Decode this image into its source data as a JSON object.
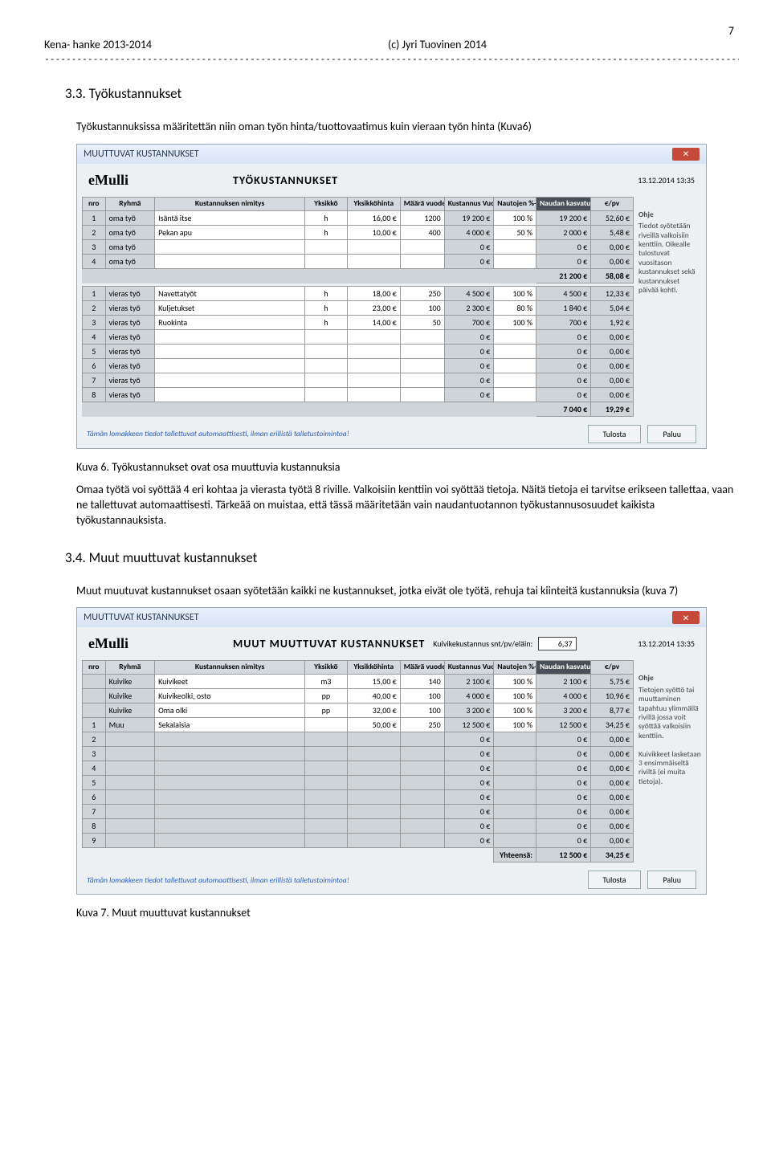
{
  "header": {
    "left": "Kena- hanke 2013-2014",
    "center": "(c) Jyri Tuovinen 2014",
    "page": "7"
  },
  "sec33": {
    "num_title": "3.3.   Työkustannukset",
    "p1": "Työkustannuksissa määritettän niin oman työn hinta/tuottovaatimus kuin vieraan työn hinta (Kuva6)",
    "caption": "Kuva 6. Työkustannukset ovat osa muuttuvia kustannuksia",
    "p2": "Omaa työtä voi syöttää 4 eri kohtaa ja vierasta työtä 8 riville. Valkoisiin kenttiin voi syöttää tietoja. Näitä tietoja ei tarvitse erikseen tallettaa, vaan ne tallettuvat automaattisesti. Tärkeää on muistaa, että tässä määritetään vain naudantuotannon työkustannusosuudet kaikista työkustannauksista."
  },
  "sec34": {
    "num_title": "3.4.   Muut muuttuvat kustannukset",
    "p1": "Muut muutuvat kustannukset osaan syötetään kaikki ne kustannukset, jotka eivät ole työtä, rehuja tai kiinteitä kustannuksia (kuva 7)",
    "caption": "Kuva 7. Muut muuttuvat kustannukset"
  },
  "dlg1": {
    "titlebar": "MUUTTUVAT KUSTANNUKSET",
    "brand": "eMulli",
    "title": "TYÖKUSTANNUKSET",
    "stamp": "13.12.2014 13:35",
    "cols": [
      "nro",
      "Ryhmä",
      "Kustannuksen nimitys",
      "Yksikkö",
      "Yksikköhinta",
      "Määrä vuodessa",
      "Kustannus Vuodessa",
      "Nautojen %- osuus",
      "Naudan kasvatuksen €/vuosi",
      "€/pv"
    ],
    "rows1": [
      [
        "1",
        "oma työ",
        "Isäntä itse",
        "h",
        "16,00 €",
        "1200",
        "19 200 €",
        "100 %",
        "19 200 €",
        "52,60 €"
      ],
      [
        "2",
        "oma työ",
        "Pekan apu",
        "h",
        "10,00 €",
        "400",
        "4 000 €",
        "50 %",
        "2 000 €",
        "5,48 €"
      ],
      [
        "3",
        "oma työ",
        "",
        "",
        "",
        "",
        "0 €",
        "",
        "0 €",
        "0,00 €"
      ],
      [
        "4",
        "oma työ",
        "",
        "",
        "",
        "",
        "0 €",
        "",
        "0 €",
        "0,00 €"
      ]
    ],
    "sum1": [
      "",
      "",
      "",
      "",
      "",
      "",
      "",
      "",
      "21 200 €",
      "58,08 €"
    ],
    "rows2": [
      [
        "1",
        "vieras työ",
        "Navettatyöt",
        "h",
        "18,00 €",
        "250",
        "4 500 €",
        "100 %",
        "4 500 €",
        "12,33 €"
      ],
      [
        "2",
        "vieras työ",
        "Kuljetukset",
        "h",
        "23,00 €",
        "100",
        "2 300 €",
        "80 %",
        "1 840 €",
        "5,04 €"
      ],
      [
        "3",
        "vieras työ",
        "Ruokinta",
        "h",
        "14,00 €",
        "50",
        "700 €",
        "100 %",
        "700 €",
        "1,92 €"
      ],
      [
        "4",
        "vieras työ",
        "",
        "",
        "",
        "",
        "0 €",
        "",
        "0 €",
        "0,00 €"
      ],
      [
        "5",
        "vieras työ",
        "",
        "",
        "",
        "",
        "0 €",
        "",
        "0 €",
        "0,00 €"
      ],
      [
        "6",
        "vieras työ",
        "",
        "",
        "",
        "",
        "0 €",
        "",
        "0 €",
        "0,00 €"
      ],
      [
        "7",
        "vieras työ",
        "",
        "",
        "",
        "",
        "0 €",
        "",
        "0 €",
        "0,00 €"
      ],
      [
        "8",
        "vieras työ",
        "",
        "",
        "",
        "",
        "0 €",
        "",
        "0 €",
        "0,00 €"
      ]
    ],
    "sum2": [
      "",
      "",
      "",
      "",
      "",
      "",
      "",
      "",
      "7 040 €",
      "19,29 €"
    ],
    "help_title": "Ohje",
    "help": "Tiedot syötetään riveillä valkoisiin kenttiin. Oikealle tulostuvat vuositason kustannukset sekä kustannukset päivää kohti.",
    "foot": "Tämän lomakkeen tiedot tallettuvat automaattisesti, ilman erillistä talletustoimintoa!",
    "btn1": "Tulosta",
    "btn2": "Paluu"
  },
  "dlg2": {
    "titlebar": "MUUTTUVAT KUSTANNUKSET",
    "brand": "eMulli",
    "title": "MUUT MUUTTUVAT KUSTANNUKSET",
    "stamp": "13.12.2014 13:35",
    "kuivike_label": "Kuivikekustannus snt/pv/eläin:",
    "kuivike_val": "6,37",
    "cols": [
      "nro",
      "Ryhmä",
      "Kustannuksen nimitys",
      "Yksikkö",
      "Yksikköhinta",
      "Määrä vuodessa",
      "Kustannus Vuodessa",
      "Nautojen %- osuus",
      "Naudan kasvatuksen €/vuosi",
      "€/pv"
    ],
    "rows": [
      [
        "",
        "Kuivike",
        "Kuivikeet",
        "m3",
        "15,00 €",
        "140",
        "2 100 €",
        "100 %",
        "2 100 €",
        "5,75 €"
      ],
      [
        "",
        "Kuivike",
        "Kuivikeolki, osto",
        "pp",
        "40,00 €",
        "100",
        "4 000 €",
        "100 %",
        "4 000 €",
        "10,96 €"
      ],
      [
        "",
        "Kuivike",
        "Oma olki",
        "pp",
        "32,00 €",
        "100",
        "3 200 €",
        "100 %",
        "3 200 €",
        "8,77 €"
      ],
      [
        "1",
        "Muu",
        "Sekalaisia",
        "",
        "50,00 €",
        "250",
        "12 500 €",
        "100 %",
        "12 500 €",
        "34,25 €"
      ],
      [
        "2",
        "",
        "",
        "",
        "",
        "",
        "0 €",
        "",
        "0 €",
        "0,00 €"
      ],
      [
        "3",
        "",
        "",
        "",
        "",
        "",
        "0 €",
        "",
        "0 €",
        "0,00 €"
      ],
      [
        "4",
        "",
        "",
        "",
        "",
        "",
        "0 €",
        "",
        "0 €",
        "0,00 €"
      ],
      [
        "5",
        "",
        "",
        "",
        "",
        "",
        "0 €",
        "",
        "0 €",
        "0,00 €"
      ],
      [
        "6",
        "",
        "",
        "",
        "",
        "",
        "0 €",
        "",
        "0 €",
        "0,00 €"
      ],
      [
        "7",
        "",
        "",
        "",
        "",
        "",
        "0 €",
        "",
        "0 €",
        "0,00 €"
      ],
      [
        "8",
        "",
        "",
        "",
        "",
        "",
        "0 €",
        "",
        "0 €",
        "0,00 €"
      ],
      [
        "9",
        "",
        "",
        "",
        "",
        "",
        "0 €",
        "",
        "0 €",
        "0,00 €"
      ]
    ],
    "sum_label": "Yhteensä:",
    "sum": "12 500 €",
    "sum_pv": "34,25 €",
    "help_title": "Ohje",
    "help": "Tietojen syöttö tai muuttaminen tapahtuu ylimmällä rivillä jossa voit syöttää valkoisiin kenttiin.\n\nKuivikkeet lasketaan 3 ensimmäiseltä riviltä (ei muita tietoja).",
    "foot": "Tämän lomakkeen tiedot tallettuvat automaattisesti, ilman erillistä talletustoimintoa!",
    "btn1": "Tulosta",
    "btn2": "Paluu"
  },
  "chart_data": [
    {
      "type": "table",
      "title": "TYÖKUSTANNUKSET",
      "series": [
        {
          "name": "oma työ",
          "rows": [
            {
              "nimitys": "Isäntä itse",
              "yksikko": "h",
              "hinta_eur": 16.0,
              "maara": 1200,
              "kust_eur": 19200,
              "osuus_pct": 100,
              "naudan_eur_vuosi": 19200,
              "eur_pv": 52.6
            },
            {
              "nimitys": "Pekan apu",
              "yksikko": "h",
              "hinta_eur": 10.0,
              "maara": 400,
              "kust_eur": 4000,
              "osuus_pct": 50,
              "naudan_eur_vuosi": 2000,
              "eur_pv": 5.48
            },
            {
              "nimitys": "",
              "kust_eur": 0,
              "naudan_eur_vuosi": 0,
              "eur_pv": 0.0
            },
            {
              "nimitys": "",
              "kust_eur": 0,
              "naudan_eur_vuosi": 0,
              "eur_pv": 0.0
            }
          ],
          "subtotal": {
            "naudan_eur_vuosi": 21200,
            "eur_pv": 58.08
          }
        },
        {
          "name": "vieras työ",
          "rows": [
            {
              "nimitys": "Navettatyöt",
              "yksikko": "h",
              "hinta_eur": 18.0,
              "maara": 250,
              "kust_eur": 4500,
              "osuus_pct": 100,
              "naudan_eur_vuosi": 4500,
              "eur_pv": 12.33
            },
            {
              "nimitys": "Kuljetukset",
              "yksikko": "h",
              "hinta_eur": 23.0,
              "maara": 100,
              "kust_eur": 2300,
              "osuus_pct": 80,
              "naudan_eur_vuosi": 1840,
              "eur_pv": 5.04
            },
            {
              "nimitys": "Ruokinta",
              "yksikko": "h",
              "hinta_eur": 14.0,
              "maara": 50,
              "kust_eur": 700,
              "osuus_pct": 100,
              "naudan_eur_vuosi": 700,
              "eur_pv": 1.92
            },
            {
              "nimitys": "",
              "kust_eur": 0,
              "naudan_eur_vuosi": 0,
              "eur_pv": 0.0
            },
            {
              "nimitys": "",
              "kust_eur": 0,
              "naudan_eur_vuosi": 0,
              "eur_pv": 0.0
            },
            {
              "nimitys": "",
              "kust_eur": 0,
              "naudan_eur_vuosi": 0,
              "eur_pv": 0.0
            },
            {
              "nimitys": "",
              "kust_eur": 0,
              "naudan_eur_vuosi": 0,
              "eur_pv": 0.0
            },
            {
              "nimitys": "",
              "kust_eur": 0,
              "naudan_eur_vuosi": 0,
              "eur_pv": 0.0
            }
          ],
          "subtotal": {
            "naudan_eur_vuosi": 7040,
            "eur_pv": 19.29
          }
        }
      ]
    },
    {
      "type": "table",
      "title": "MUUT MUUTTUVAT KUSTANNUKSET",
      "kuivikekustannus_snt_pv_elain": 6.37,
      "rows": [
        {
          "ryhma": "Kuivike",
          "nimitys": "Kuivikeet",
          "yksikko": "m3",
          "hinta_eur": 15.0,
          "maara": 140,
          "kust_eur": 2100,
          "osuus_pct": 100,
          "naudan_eur_vuosi": 2100,
          "eur_pv": 5.75
        },
        {
          "ryhma": "Kuivike",
          "nimitys": "Kuivikeolki, osto",
          "yksikko": "pp",
          "hinta_eur": 40.0,
          "maara": 100,
          "kust_eur": 4000,
          "osuus_pct": 100,
          "naudan_eur_vuosi": 4000,
          "eur_pv": 10.96
        },
        {
          "ryhma": "Kuivike",
          "nimitys": "Oma olki",
          "yksikko": "pp",
          "hinta_eur": 32.0,
          "maara": 100,
          "kust_eur": 3200,
          "osuus_pct": 100,
          "naudan_eur_vuosi": 3200,
          "eur_pv": 8.77
        },
        {
          "ryhma": "Muu",
          "nimitys": "Sekalaisia",
          "yksikko": "",
          "hinta_eur": 50.0,
          "maara": 250,
          "kust_eur": 12500,
          "osuus_pct": 100,
          "naudan_eur_vuosi": 12500,
          "eur_pv": 34.25
        }
      ],
      "total": {
        "naudan_eur_vuosi": 12500,
        "eur_pv": 34.25
      }
    }
  ]
}
